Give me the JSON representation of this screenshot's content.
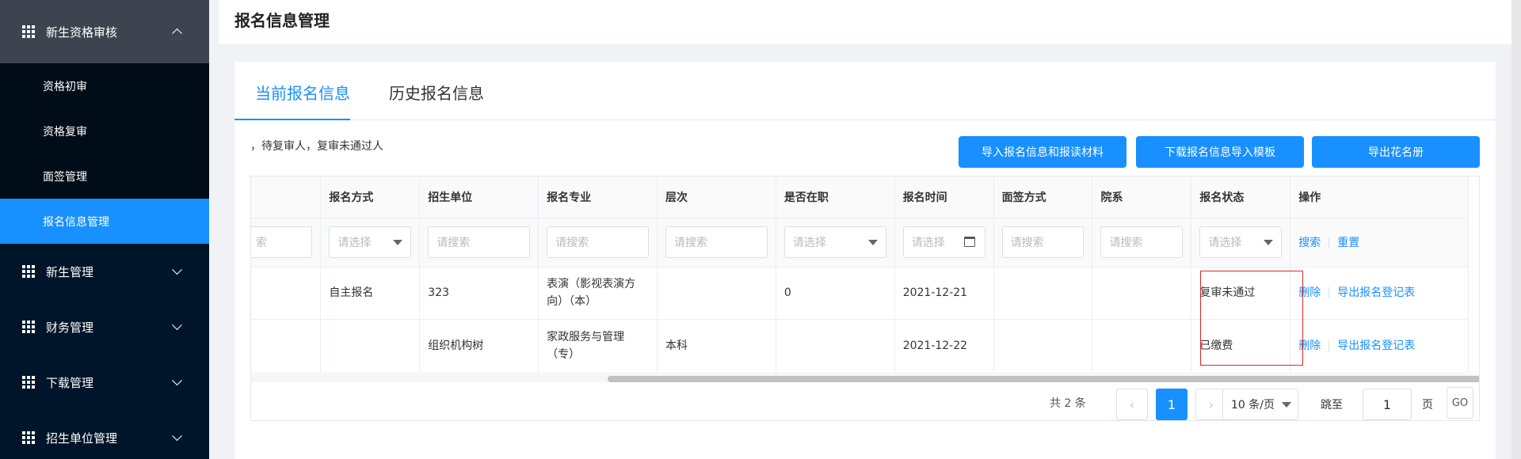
{
  "sidebar": {
    "group": {
      "label": "新生资格审核",
      "icon": "grid-icon",
      "expanded": true
    },
    "sub_items": [
      {
        "label": "资格初审",
        "active": false
      },
      {
        "label": "资格复审",
        "active": false
      },
      {
        "label": "面签管理",
        "active": false
      },
      {
        "label": "报名信息管理",
        "active": true
      }
    ],
    "menu_items": [
      {
        "label": "新生管理",
        "icon": "grid-icon"
      },
      {
        "label": "财务管理",
        "icon": "grid-icon"
      },
      {
        "label": "下载管理",
        "icon": "grid-icon"
      },
      {
        "label": "招生单位管理",
        "icon": "grid-icon"
      }
    ]
  },
  "header": {
    "title": "报名信息管理"
  },
  "tabs": [
    {
      "label": "当前报名信息",
      "active": true
    },
    {
      "label": "历史报名信息",
      "active": false
    }
  ],
  "note": "，待复审人，复审未通过人",
  "toolbar": {
    "import_label": "导入报名信息和报读材料",
    "download_template_label": "下载报名信息导入模板",
    "export_roster_label": "导出花名册"
  },
  "table": {
    "columns": [
      "报名方式",
      "招生单位",
      "报名专业",
      "层次",
      "是否在职",
      "报名时间",
      "面签方式",
      "院系",
      "报名状态",
      "操作"
    ],
    "filters": {
      "partial_search": "索",
      "select_placeholder": "请选择",
      "search_placeholder": "请搜索",
      "search_action": "搜索",
      "reset_action": "重置"
    },
    "rows": [
      {
        "method": "自主报名",
        "unit": "323",
        "major": "表演（影视表演方向）（本）",
        "level": "",
        "employed": "0",
        "time": "2021-12-21",
        "interview": "",
        "dept": "",
        "status": "复审未通过",
        "action_delete": "删除",
        "action_export": "导出报名登记表"
      },
      {
        "method": "",
        "unit": "组织机构树",
        "major": "家政服务与管理（专）",
        "level": "本科",
        "employed": "",
        "time": "2021-12-22",
        "interview": "",
        "dept": "",
        "status": "已缴费",
        "action_delete": "删除",
        "action_export": "导出报名登记表"
      }
    ]
  },
  "pagination": {
    "total": "共 2 条",
    "prev": "‹",
    "current_page": "1",
    "next": "›",
    "page_size": "10 条/页",
    "jump_label": "跳至",
    "jump_value": "1",
    "page_unit": "页",
    "go": "GO"
  },
  "colors": {
    "primary": "#1890ff",
    "sidebar": "#001529",
    "highlight": "#e0262b"
  }
}
